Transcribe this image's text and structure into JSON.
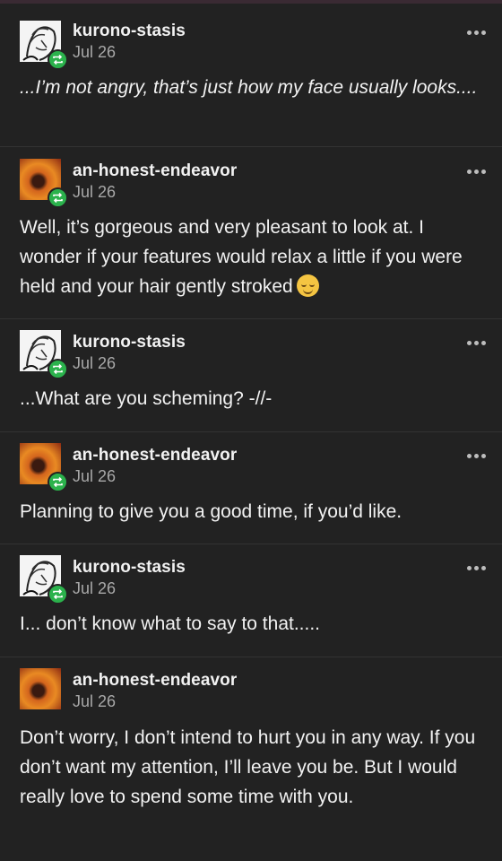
{
  "posts": [
    {
      "user": "kurono-stasis",
      "date": "Jul 26",
      "text": "...I’m not angry, that’s just how my face usually looks....",
      "avatar": "kurono-avatar"
    },
    {
      "user": "an-honest-endeavor",
      "date": "Jul 26",
      "text": "Well, it’s gorgeous and very pleasant to look at. I wonder if your features would relax a little if you were held and your hair gently stroked",
      "emoji": "smiling-face-emoji",
      "avatar": "endeavor-avatar"
    },
    {
      "user": "kurono-stasis",
      "date": "Jul 26",
      "text": "...What are you scheming? -//-",
      "avatar": "kurono-avatar"
    },
    {
      "user": "an-honest-endeavor",
      "date": "Jul 26",
      "text": "Planning to give you a good time, if you’d like.",
      "avatar": "endeavor-avatar"
    },
    {
      "user": "kurono-stasis",
      "date": "Jul 26",
      "text": "I... don’t know what to say to that.....",
      "avatar": "kurono-avatar"
    },
    {
      "user": "an-honest-endeavor",
      "date": "Jul 26",
      "text": "Don’t worry, I don’t intend to hurt you in any way. If you don’t want my attention, I’ll leave you be. But I would really love to spend some time with you.",
      "avatar": "endeavor-avatar"
    }
  ],
  "icons": {
    "reblog": "reblog-icon",
    "more": "more-options-icon"
  },
  "colors": {
    "background": "#222222",
    "reblog_badge": "#2bb24c",
    "divider": "#333333"
  }
}
